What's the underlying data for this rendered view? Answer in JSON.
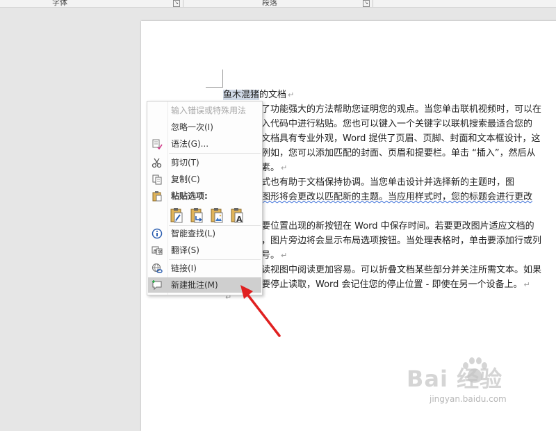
{
  "ribbon": {
    "group_font": "字体",
    "group_paragraph": "段落",
    "launcher_glyph": "↘"
  },
  "document": {
    "line1_selected": "鱼木混猪",
    "line1_rest": "的文档",
    "lines": [
      "了功能强大的方法帮助您证明您的观点。当您单击联机视频时，可以在",
      "入代码中进行粘贴。您也可以键入一个关键字以联机搜索最适合您的",
      "文档具有专业外观，Word 提供了页眉、页脚、封面和文本框设计，这",
      "例如，您可以添加匹配的封面、页眉和提要栏。单击 “插入”，然后从",
      "素。",
      "式也有助于文档保持协调。当您单击设计并选择新的主题时，图",
      "图形将会更改以匹配新的主题。当应用样式时，您的标题会进行更改",
      "",
      "要位置出现的新按钮在 Word 中保存时间。若要更改图片适应文档的",
      "，图片旁边将会显示布局选项按钮。当处理表格时，单击要添加行或列",
      "号。",
      "读视图中阅读更加容易。可以折叠文档某些部分并关注所需文本。如果",
      "要停止读取，Word 会记住您的停止位置 - 即使在另一个设备上。"
    ],
    "paragraph_mark": "↵"
  },
  "context_menu": {
    "items": [
      {
        "label": "输入错误或特殊用法",
        "icon": "",
        "disabled": true
      },
      {
        "label": "忽略一次(I)",
        "icon": ""
      },
      {
        "label": "语法(G)...",
        "icon": "grammar-icon"
      },
      {
        "label": "剪切(T)",
        "icon": "scissors-icon"
      },
      {
        "label": "复制(C)",
        "icon": "copy-icon"
      },
      {
        "label": "粘贴选项:",
        "icon": "clipboard-icon",
        "header": true
      },
      {
        "label": "智能查找(L)",
        "icon": "info-icon"
      },
      {
        "label": "翻译(S)",
        "icon": "translate-icon"
      },
      {
        "label": "链接(I)",
        "icon": "link-icon"
      },
      {
        "label": "新建批注(M)",
        "icon": "new-comment-icon",
        "highlighted": true
      }
    ],
    "paste_options": [
      "keep-source-formatting-icon",
      "merge-formatting-icon",
      "picture-icon",
      "keep-text-only-icon"
    ]
  },
  "annotation": {
    "arrow_color": "#e02020"
  },
  "watermark": {
    "logo_text": "Bai 经验",
    "url": "jingyan.baidu.com"
  }
}
